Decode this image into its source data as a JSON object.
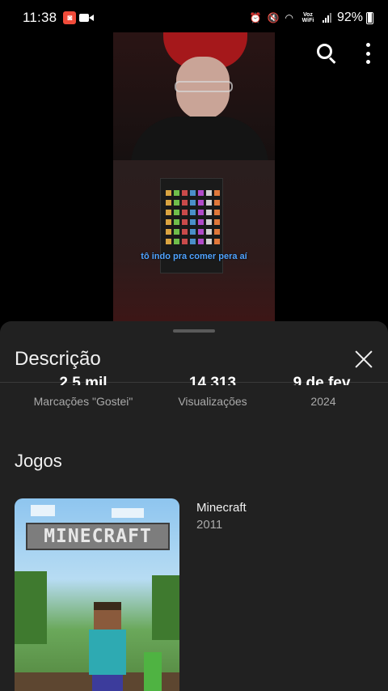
{
  "status_bar": {
    "time": "11:38",
    "voz_wifi": "Voz WiFi",
    "battery": "92%"
  },
  "video": {
    "subtitle": "tô indo pra comer pera aí"
  },
  "sheet": {
    "title": "Descrição",
    "stats": [
      {
        "value": "2,5 mil",
        "label": "Marcações \"Gostei\""
      },
      {
        "value": "14.313",
        "label": "Visualizações"
      },
      {
        "value": "9 de fev.",
        "label": "2024"
      }
    ],
    "games_section_title": "Jogos",
    "game": {
      "logo_text": "MINECRAFT",
      "name": "Minecraft",
      "year": "2011"
    }
  },
  "colors": {
    "sheet_bg": "#212121",
    "subtitle": "#4fa3ff",
    "secondary_text": "#aaaaaa"
  }
}
